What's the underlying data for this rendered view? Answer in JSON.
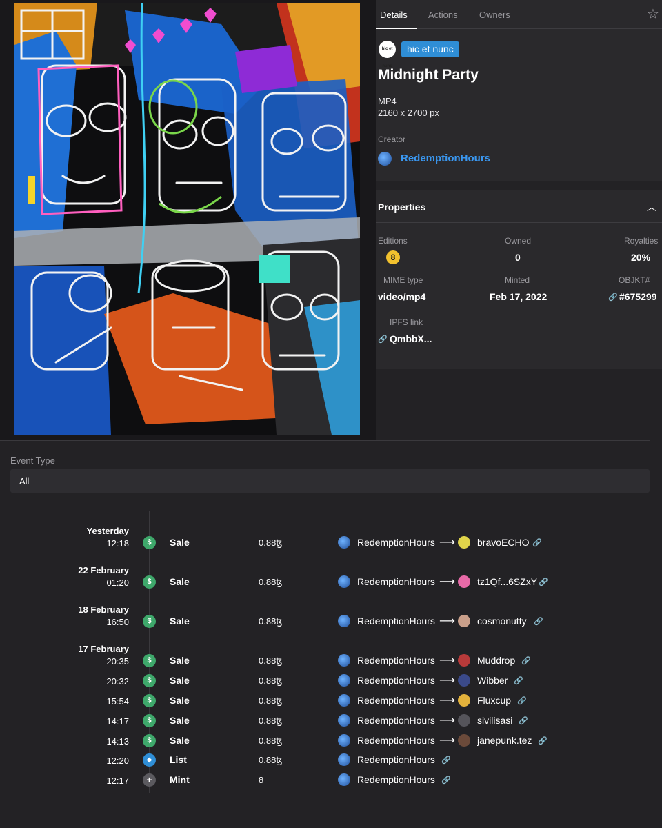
{
  "tabs": {
    "details": "Details",
    "actions": "Actions",
    "owners": "Owners"
  },
  "icons": {
    "favorite": "star-icon",
    "collapse": "chevron-up-icon",
    "link": "link-icon",
    "sale": "dollar-icon",
    "list": "tag-icon",
    "mint": "plus-icon"
  },
  "platform": {
    "avatar_text": "hic et nunc",
    "badge": "hic et nunc"
  },
  "artwork": {
    "title": "Midnight Party",
    "format": "MP4",
    "dimensions": "2160 x 2700 px",
    "creator_label": "Creator",
    "creator": "RedemptionHours"
  },
  "properties": {
    "header": "Properties",
    "editions_label": "Editions",
    "editions": "8",
    "owned_label": "Owned",
    "owned": "0",
    "royalties_label": "Royalties",
    "royalties": "20%",
    "mime_label": "MIME type",
    "mime": "video/mp4",
    "minted_label": "Minted",
    "minted": "Feb 17, 2022",
    "objkt_label": "OBJKT#",
    "objkt": "#675299",
    "ipfs_label": "IPFS link",
    "ipfs": "QmbbX..."
  },
  "event_filter": {
    "label": "Event Type",
    "value": "All"
  },
  "history": {
    "groups": [
      {
        "date": "Yesterday",
        "events": [
          {
            "time": "12:18",
            "type": "Sale",
            "price": "0.88ꜩ",
            "from": "RedemptionHours",
            "to": "bravoECHO"
          }
        ]
      },
      {
        "date": "22 February",
        "events": [
          {
            "time": "01:20",
            "type": "Sale",
            "price": "0.88ꜩ",
            "from": "RedemptionHours",
            "to": "tz1Qf...6SZxY"
          }
        ]
      },
      {
        "date": "18 February",
        "events": [
          {
            "time": "16:50",
            "type": "Sale",
            "price": "0.88ꜩ",
            "from": "RedemptionHours",
            "to": "cosmonutty"
          }
        ]
      },
      {
        "date": "17 February",
        "events": [
          {
            "time": "20:35",
            "type": "Sale",
            "price": "0.88ꜩ",
            "from": "RedemptionHours",
            "to": "Muddrop"
          },
          {
            "time": "20:32",
            "type": "Sale",
            "price": "0.88ꜩ",
            "from": "RedemptionHours",
            "to": "Wibber"
          },
          {
            "time": "15:54",
            "type": "Sale",
            "price": "0.88ꜩ",
            "from": "RedemptionHours",
            "to": "Fluxcup"
          },
          {
            "time": "14:17",
            "type": "Sale",
            "price": "0.88ꜩ",
            "from": "RedemptionHours",
            "to": "sivilisasi"
          },
          {
            "time": "14:13",
            "type": "Sale",
            "price": "0.88ꜩ",
            "from": "RedemptionHours",
            "to": "janepunk.tez"
          },
          {
            "time": "12:20",
            "type": "List",
            "price": "0.88ꜩ",
            "from": "RedemptionHours",
            "to": ""
          },
          {
            "time": "12:17",
            "type": "Mint",
            "price": "8",
            "from": "RedemptionHours",
            "to": ""
          }
        ]
      }
    ]
  },
  "colors": {
    "background": "#232225",
    "panel": "#2a292c",
    "accent_blue": "#2f8ed6",
    "creator_link": "#3a97f0",
    "sale_green": "#3ea86b",
    "edition_yellow": "#f2c12e"
  }
}
